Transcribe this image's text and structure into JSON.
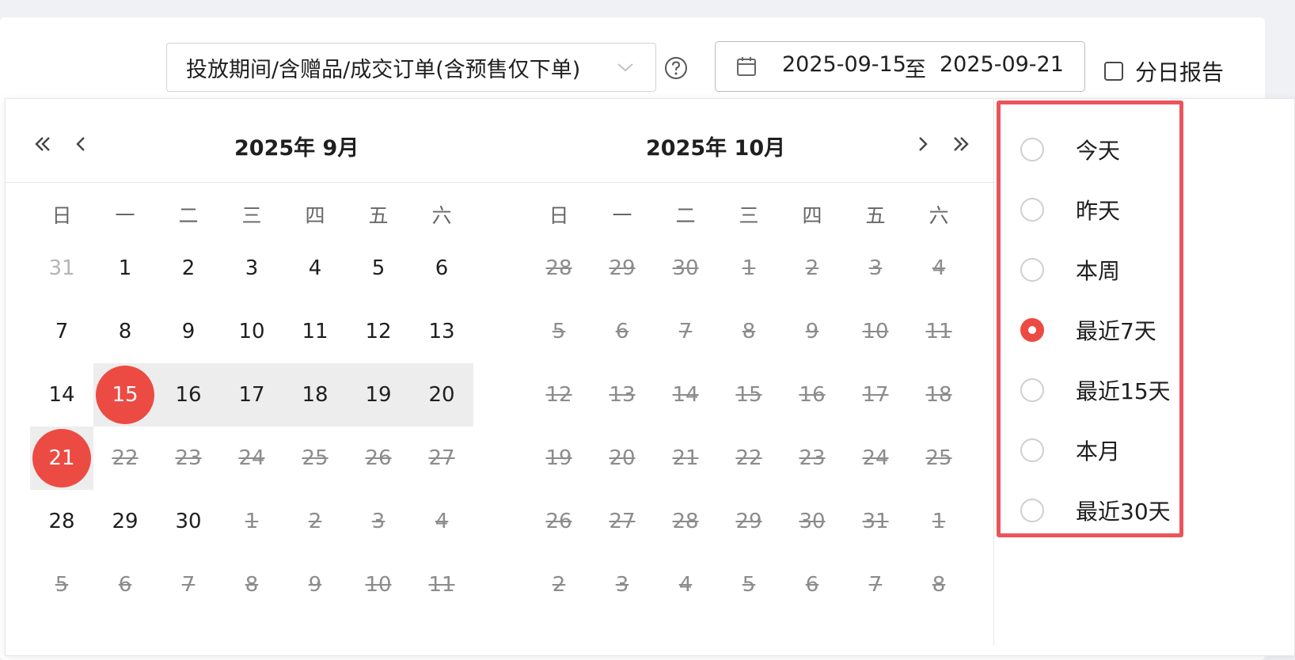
{
  "toolbar": {
    "metric_select_value": "投放期间/含赠品/成交订单(含预售仅下单)",
    "date_range": {
      "start": "2025-09-15",
      "separator": "至",
      "end": "2025-09-21"
    },
    "daily_report_label": "分日报告",
    "daily_report_checked": false
  },
  "calendar": {
    "left_title": "2025年 9月",
    "right_title": "2025年 10月",
    "weekdays": [
      "日",
      "一",
      "二",
      "三",
      "四",
      "五",
      "六"
    ],
    "left_days": [
      [
        "31",
        "1",
        "2",
        "3",
        "4",
        "5",
        "6"
      ],
      [
        "7",
        "8",
        "9",
        "10",
        "11",
        "12",
        "13"
      ],
      [
        "14",
        "15",
        "16",
        "17",
        "18",
        "19",
        "20"
      ],
      [
        "21",
        "22",
        "23",
        "24",
        "25",
        "26",
        "27"
      ],
      [
        "28",
        "29",
        "30",
        "1",
        "2",
        "3",
        "4"
      ],
      [
        "5",
        "6",
        "7",
        "8",
        "9",
        "10",
        "11"
      ]
    ],
    "right_days": [
      [
        "28",
        "29",
        "30",
        "1",
        "2",
        "3",
        "4"
      ],
      [
        "5",
        "6",
        "7",
        "8",
        "9",
        "10",
        "11"
      ],
      [
        "12",
        "13",
        "14",
        "15",
        "16",
        "17",
        "18"
      ],
      [
        "19",
        "20",
        "21",
        "22",
        "23",
        "24",
        "25"
      ],
      [
        "26",
        "27",
        "28",
        "29",
        "30",
        "31",
        "1"
      ],
      [
        "2",
        "3",
        "4",
        "5",
        "6",
        "7",
        "8"
      ]
    ],
    "selected_start": "2025-09-15",
    "selected_end": "2025-09-21",
    "max_selectable": "2025-09-21"
  },
  "shortcuts": [
    {
      "label": "今天",
      "checked": false
    },
    {
      "label": "昨天",
      "checked": false
    },
    {
      "label": "本周",
      "checked": false
    },
    {
      "label": "最近7天",
      "checked": true
    },
    {
      "label": "最近15天",
      "checked": false
    },
    {
      "label": "本月",
      "checked": false
    },
    {
      "label": "最近30天",
      "checked": false
    }
  ],
  "colors": {
    "accent": "#ec4b43",
    "highlight_border": "#ec535a",
    "range_bg": "#ededed"
  },
  "icons": [
    "chevron-down-icon",
    "help-circle-icon",
    "calendar-icon",
    "double-chevron-left-icon",
    "chevron-left-icon",
    "chevron-right-icon",
    "double-chevron-right-icon"
  ]
}
